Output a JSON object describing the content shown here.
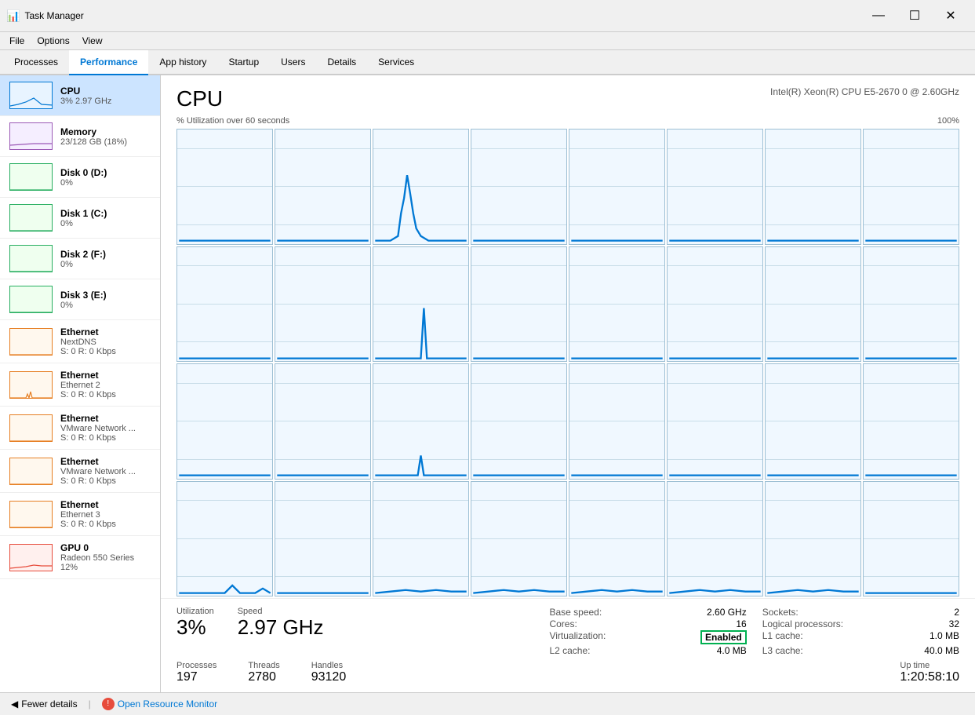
{
  "window": {
    "title": "Task Manager",
    "icon": "⊞"
  },
  "menu": {
    "items": [
      "File",
      "Options",
      "View"
    ]
  },
  "tabs": {
    "items": [
      "Processes",
      "Performance",
      "App history",
      "Startup",
      "Users",
      "Details",
      "Services"
    ],
    "active": "Performance"
  },
  "sidebar": {
    "items": [
      {
        "id": "cpu",
        "name": "CPU",
        "sub": "3% 2.97 GHz",
        "type": "cpu",
        "active": true
      },
      {
        "id": "memory",
        "name": "Memory",
        "sub": "23/128 GB (18%)",
        "type": "memory"
      },
      {
        "id": "disk0",
        "name": "Disk 0 (D:)",
        "sub": "0%",
        "type": "disk"
      },
      {
        "id": "disk1",
        "name": "Disk 1 (C:)",
        "sub": "0%",
        "type": "disk"
      },
      {
        "id": "disk2",
        "name": "Disk 2 (F:)",
        "sub": "0%",
        "type": "disk"
      },
      {
        "id": "disk3",
        "name": "Disk 3 (E:)",
        "sub": "0%",
        "type": "disk"
      },
      {
        "id": "eth0",
        "name": "Ethernet",
        "sub2": "NextDNS",
        "sub": "S: 0 R: 0 Kbps",
        "type": "ethernet"
      },
      {
        "id": "eth1",
        "name": "Ethernet",
        "sub2": "Ethernet 2",
        "sub": "S: 0 R: 0 Kbps",
        "type": "ethernet"
      },
      {
        "id": "eth2",
        "name": "Ethernet",
        "sub2": "VMware Network ...",
        "sub": "S: 0 R: 0 Kbps",
        "type": "ethernet"
      },
      {
        "id": "eth3",
        "name": "Ethernet",
        "sub2": "VMware Network ...",
        "sub": "S: 0 R: 0 Kbps",
        "type": "ethernet"
      },
      {
        "id": "eth4",
        "name": "Ethernet",
        "sub2": "Ethernet 3",
        "sub": "S: 0 R: 0 Kbps",
        "type": "ethernet"
      },
      {
        "id": "gpu0",
        "name": "GPU 0",
        "sub2": "Radeon 550 Series",
        "sub": "12%",
        "type": "gpu"
      }
    ]
  },
  "content": {
    "title": "CPU",
    "subtitle": "Intel(R) Xeon(R) CPU E5-2670 0 @ 2.60GHz",
    "chart_label": "% Utilization over 60 seconds",
    "chart_max": "100%",
    "stats": {
      "utilization_label": "Utilization",
      "utilization_value": "3%",
      "speed_label": "Speed",
      "speed_value": "2.97 GHz",
      "processes_label": "Processes",
      "processes_value": "197",
      "threads_label": "Threads",
      "threads_value": "2780",
      "handles_label": "Handles",
      "handles_value": "93120",
      "uptime_label": "Up time",
      "uptime_value": "1:20:58:10"
    },
    "details": [
      {
        "label": "Base speed:",
        "value": "2.60 GHz"
      },
      {
        "label": "Sockets:",
        "value": "2"
      },
      {
        "label": "Cores:",
        "value": "16"
      },
      {
        "label": "Logical processors:",
        "value": "32"
      },
      {
        "label": "Virtualization:",
        "value": "Enabled",
        "highlight": true
      },
      {
        "label": "L1 cache:",
        "value": "1.0 MB"
      },
      {
        "label": "L2 cache:",
        "value": "4.0 MB"
      },
      {
        "label": "L3 cache:",
        "value": "40.0 MB"
      }
    ]
  },
  "bottom_bar": {
    "fewer_details": "Fewer details",
    "open_resource": "Open Resource Monitor"
  }
}
